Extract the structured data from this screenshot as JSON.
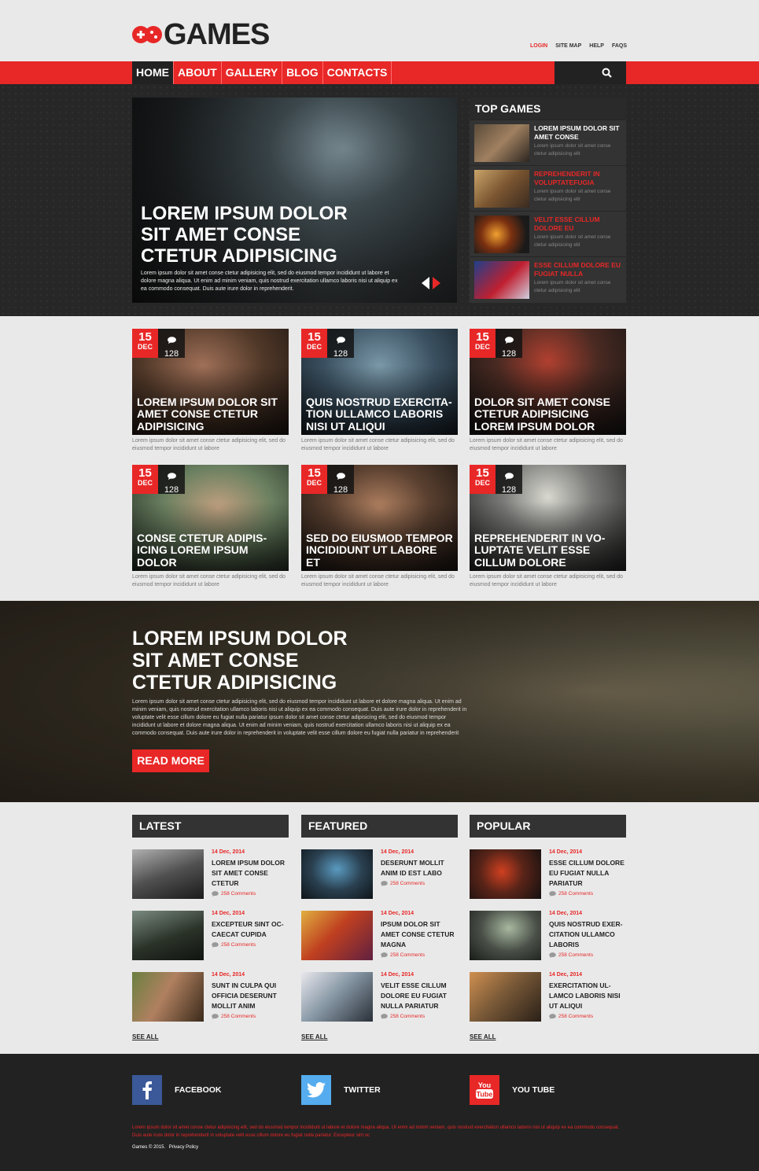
{
  "header": {
    "logo_text": "GAMES",
    "toplinks": [
      "LOGIN",
      "SITE MAP",
      "HELP",
      "FAQS"
    ]
  },
  "nav": [
    "HOME",
    "ABOUT",
    "GALLERY",
    "BLOG",
    "CONTACTS"
  ],
  "hero": {
    "title": "LOREM IPSUM DOLOR SIT AMET CONSE CTETUR ADIPISICING",
    "desc": "Lorem ipsum dolor sit amet conse ctetur adipisicing elit, sed do eiusmod tempor incididunt ut labore et dolore magna aliqua. Ut enim ad minim veniam, quis nostrud exercitation ullamco laboris nisi ut aliquip ex ea commodo consequat. Duis aute irure dolor in reprehenderit."
  },
  "top_games": {
    "title": "TOP GAMES",
    "items": [
      {
        "name": "LOREM IPSUM DOLOR SIT AMET CONSE",
        "desc": "Lorem ipsum dolor sit amet conse ctetur adipisicing elit"
      },
      {
        "name": "REPREHENDERIT IN VOLUPTATEFUGIA",
        "desc": "Lorem ipsum dolor sit amet conse ctetur adipisicing elit"
      },
      {
        "name": "VELIT ESSE CILLUM DOLORE EU",
        "desc": "Lorem ipsum dolor sit amet conse ctetur adipisicing elit"
      },
      {
        "name": "ESSE CILLUM DOLORE EU FUGIAT NULLA",
        "desc": "Lorem ipsum dolor sit amet conse ctetur adipisicing elit"
      }
    ]
  },
  "cards": [
    {
      "day": "15",
      "month": "DEC",
      "comments": "128",
      "title": "LOREM IPSUM DOLOR SIT AMET CONSE CTETUR ADIPISICING",
      "desc": "Lorem ipsum dolor sit amet conse ctetur adipisicing elit, sed do eiusmod tempor incididunt ut labore"
    },
    {
      "day": "15",
      "month": "DEC",
      "comments": "128",
      "title": "QUIS NOSTRUD EXERCITA-TION ULLAMCO LABORIS NISI UT ALIQUI",
      "desc": "Lorem ipsum dolor sit amet conse ctetur adipisicing elit, sed do eiusmod tempor incididunt ut labore"
    },
    {
      "day": "15",
      "month": "DEC",
      "comments": "128",
      "title": "DOLOR SIT AMET CONSE CTETUR ADIPISICING LOREM IPSUM DOLOR",
      "desc": "Lorem ipsum dolor sit amet conse ctetur adipisicing elit, sed do eiusmod tempor incididunt ut labore"
    },
    {
      "day": "15",
      "month": "DEC",
      "comments": "128",
      "title": "CONSE CTETUR ADIPIS-ICING LOREM IPSUM DOLOR",
      "desc": "Lorem ipsum dolor sit amet conse ctetur adipisicing elit, sed do eiusmod tempor incididunt ut labore"
    },
    {
      "day": "15",
      "month": "DEC",
      "comments": "128",
      "title": "SED DO EIUSMOD TEMPOR INCIDIDUNT UT LABORE ET",
      "desc": "Lorem ipsum dolor sit amet conse ctetur adipisicing elit, sed do eiusmod tempor incididunt ut labore"
    },
    {
      "day": "15",
      "month": "DEC",
      "comments": "128",
      "title": "REPREHENDERIT IN VO-LUPTATE VELIT ESSE CILLUM DOLORE",
      "desc": "Lorem ipsum dolor sit amet conse ctetur adipisicing elit, sed do eiusmod tempor incididunt ut labore"
    }
  ],
  "feature": {
    "title": "LOREM IPSUM DOLOR SIT AMET CONSE CTETUR ADIPISICING",
    "desc": "Lorem ipsum dolor sit amet conse ctetur adipisicing elit, sed do eiusmod tempor incididunt ut labore et dolore magna aliqua. Ut enim ad minim veniam, quis nostrud exercitation ullamco laboris nisi ut aliquip ex ea commodo consequat. Duis aute irure dolor in reprehenderit in voluptate velit esse cillum dolore eu fugiat nulla pariatur ipsum dolor sit amet conse ctetur adipisicing elit, sed do eiusmod tempor incididunt ut labore et dolore magna aliqua. Ut enim ad minim veniam, quis nostrud exercitation ullamco laboris nisi ut aliquip ex ea commodo consequat. Duis aute irure dolor in reprehenderit in voluptate velit esse cillum dolore eu fugiat nulla pariatur in reprehenderit",
    "button": "READ MORE"
  },
  "lists": [
    {
      "title": "LATEST",
      "items": [
        {
          "date": "14 Dec, 2014",
          "title": "LOREM IPSUM DOLOR SIT AMET CONSE CTETUR",
          "comments": "258 Comments"
        },
        {
          "date": "14 Dec, 2014",
          "title": "EXCEPTEUR SINT OC-CAECAT CUPIDA",
          "comments": "258 Comments"
        },
        {
          "date": "14 Dec, 2014",
          "title": "SUNT IN CULPA QUI OFFICIA DESERUNT MOLLIT ANIM",
          "comments": "258 Comments"
        }
      ],
      "see_all": "SEE ALL"
    },
    {
      "title": "FEATURED",
      "items": [
        {
          "date": "14 Dec, 2014",
          "title": "DESERUNT MOLLIT ANIM ID EST LABO",
          "comments": "258 Comments"
        },
        {
          "date": "14 Dec, 2014",
          "title": "IPSUM DOLOR SIT AMET CONSE CTETUR MAGNA",
          "comments": "258 Comments"
        },
        {
          "date": "14 Dec, 2014",
          "title": "VELIT ESSE CILLUM DOLORE EU FUGIAT NULLA PARIATUR",
          "comments": "258 Comments"
        }
      ],
      "see_all": "SEE ALL"
    },
    {
      "title": "POPULAR",
      "items": [
        {
          "date": "14 Dec, 2014",
          "title": "ESSE CILLUM DOLORE EU FUGIAT NULLA PARIATUR",
          "comments": "258 Comments"
        },
        {
          "date": "14 Dec, 2014",
          "title": "QUIS NOSTRUD EXER-CITATION ULLAMCO LABORIS",
          "comments": "258 Comments"
        },
        {
          "date": "14 Dec, 2014",
          "title": "EXERCITATION UL-LAMCO LABORIS NISI UT ALIQUI",
          "comments": "258 Comments"
        }
      ],
      "see_all": "SEE ALL"
    }
  ],
  "footer": {
    "social": [
      {
        "label": "FACEBOOK",
        "icon": "facebook-icon",
        "color": "#3b5998"
      },
      {
        "label": "TWITTER",
        "icon": "twitter-icon",
        "color": "#55acee"
      },
      {
        "label": "YOU TUBE",
        "icon": "youtube-icon",
        "color": "#e82727"
      }
    ],
    "text": "Lorem ipsum dolor sit amet conse ctetur adipisicing elit, sed do eiusmod tempor incididunt ut labore et dolore magna aliqua. Ut enim ad minim veniam, quis nostrud exercitation ullamco laboris nisi ut aliquip ex ea commodo consequat. Duis aute irure dolor in reprehenderit in voluptate velit esse cillum dolore eu fugiat nulla pariatur. Excepteur sint oc",
    "copyright": "Games © 2015.",
    "privacy": "Privacy Policy"
  },
  "colors": {
    "accent": "#e82727",
    "dark": "#222222",
    "panel": "#333333"
  }
}
